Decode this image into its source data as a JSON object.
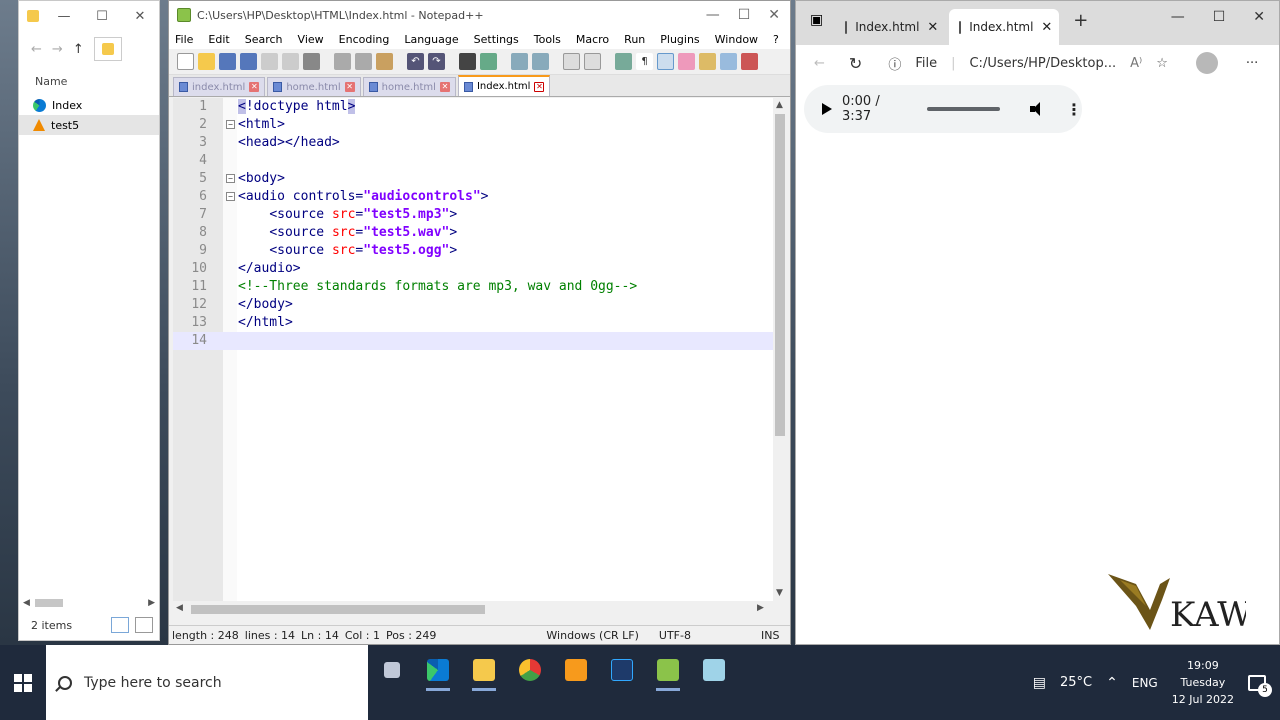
{
  "explorer": {
    "column_header": "Name",
    "items": [
      {
        "label": "Index",
        "icon": "edge-icon"
      },
      {
        "label": "test5",
        "icon": "vlc-icon"
      }
    ],
    "status": "2 items"
  },
  "npp": {
    "title": "C:\\Users\\HP\\Desktop\\HTML\\Index.html - Notepad++",
    "menu": [
      "File",
      "Edit",
      "Search",
      "View",
      "Encoding",
      "Language",
      "Settings",
      "Tools",
      "Macro",
      "Run",
      "Plugins",
      "Window",
      "?"
    ],
    "menu_close": "X",
    "tabs": [
      {
        "label": "index.html",
        "active": false
      },
      {
        "label": "home.html",
        "active": false
      },
      {
        "label": "home.html",
        "active": false
      },
      {
        "label": "Index.html",
        "active": true
      }
    ],
    "lines": [
      {
        "n": "1",
        "html": "<span class=\"tag hl\">&lt;</span><span class=\"tag\">!doctype html</span><span class=\"tag hl\">&gt;</span>"
      },
      {
        "n": "2",
        "html": "<span class=\"tag\">&lt;html&gt;</span>"
      },
      {
        "n": "3",
        "html": "<span class=\"tag\">&lt;head&gt;&lt;/head&gt;</span>"
      },
      {
        "n": "4",
        "html": ""
      },
      {
        "n": "5",
        "html": "<span class=\"tag\">&lt;body&gt;</span>"
      },
      {
        "n": "6",
        "html": "<span class=\"tag\">&lt;audio </span><span class=\"tag\">controls</span><span class=\"tag\">=</span><span class=\"val\">\"audiocontrols\"</span><span class=\"tag\">&gt;</span>"
      },
      {
        "n": "7",
        "html": "    <span class=\"tag\">&lt;source </span><span class=\"attr\">src</span><span class=\"tag\">=</span><span class=\"val\">\"test5.mp3\"</span><span class=\"tag\">&gt;</span>"
      },
      {
        "n": "8",
        "html": "    <span class=\"tag\">&lt;source </span><span class=\"attr\">src</span><span class=\"tag\">=</span><span class=\"val\">\"test5.wav\"</span><span class=\"tag\">&gt;</span>"
      },
      {
        "n": "9",
        "html": "    <span class=\"tag\">&lt;source </span><span class=\"attr\">src</span><span class=\"tag\">=</span><span class=\"val\">\"test5.ogg\"</span><span class=\"tag\">&gt;</span>"
      },
      {
        "n": "10",
        "html": "<span class=\"tag\">&lt;/audio&gt;</span>"
      },
      {
        "n": "11",
        "html": "<span class=\"cmt\">&lt;!--Three standards formats are mp3, wav and 0gg--&gt;</span>"
      },
      {
        "n": "12",
        "html": "<span class=\"tag\">&lt;/body&gt;</span>"
      },
      {
        "n": "13",
        "html": "<span class=\"tag\">&lt;/html&gt;</span>"
      },
      {
        "n": "14",
        "html": ""
      }
    ],
    "status": {
      "length": "length : 248",
      "lines": "lines : 14",
      "ln": "Ln : 14",
      "col": "Col : 1",
      "pos": "Pos : 249",
      "eol": "Windows (CR LF)",
      "encoding": "UTF-8",
      "mode": "INS"
    }
  },
  "edge": {
    "tabs": [
      {
        "label": "Index.html",
        "active": false
      },
      {
        "label": "Index.html",
        "active": true
      }
    ],
    "new_tab": "+",
    "address_prefix": "File",
    "address": "C:/Users/HP/Desktop...",
    "read_aloud": "A⁾",
    "player_time": "0:00 / 3:37",
    "more": "⋮"
  },
  "watermark": "KAWA",
  "taskbar": {
    "search_placeholder": "Type here to search",
    "weather": "25°C",
    "lang": "ENG",
    "time": "19:09",
    "day": "Tuesday",
    "date": "12 Jul 2022",
    "notifications": "5"
  },
  "colors": {
    "tab_accent": "#f89a1c",
    "tag": "#000080",
    "attr": "#ff0000",
    "value": "#8000ff",
    "comment": "#008000",
    "taskbar": "#1f2a3c"
  }
}
